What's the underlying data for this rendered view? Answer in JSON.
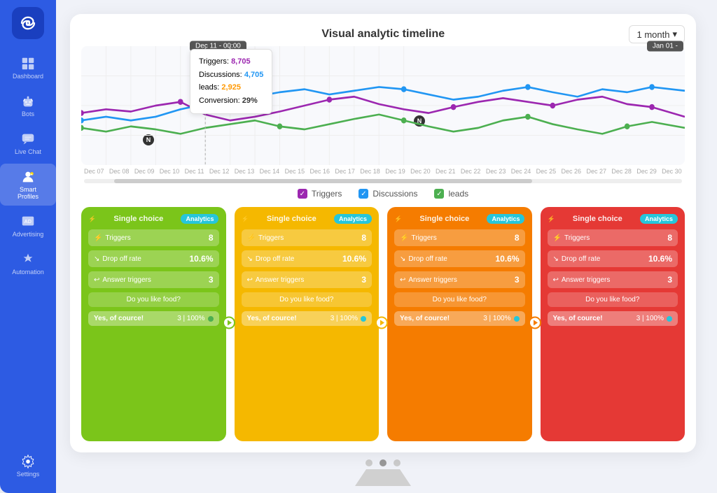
{
  "sidebar": {
    "logo_alt": "infinity-logo",
    "items": [
      {
        "id": "dashboard",
        "label": "Dashboard",
        "active": false
      },
      {
        "id": "bots",
        "label": "Bots",
        "active": false
      },
      {
        "id": "live-chat",
        "label": "Live Chat",
        "active": false
      },
      {
        "id": "smart-profiles",
        "label": "Smart Profiles",
        "active": true
      },
      {
        "id": "advertising",
        "label": "Advertising",
        "active": false
      },
      {
        "id": "automation",
        "label": "Automation",
        "active": false
      },
      {
        "id": "settings",
        "label": "Settings",
        "active": false
      }
    ]
  },
  "chart": {
    "title": "Visual analytic timeline",
    "time_filter": "1 month",
    "tooltip": {
      "date": "Dec 11 - 00:00",
      "date_right": "Jan 01 -",
      "triggers_label": "Triggers:",
      "triggers_value": "8,705",
      "discussions_label": "Discussions:",
      "discussions_value": "4,705",
      "leads_label": "leads:",
      "leads_value": "2,925",
      "conversion_label": "Conversion:",
      "conversion_value": "29%"
    },
    "x_labels": [
      "Dec 07",
      "Dec 08",
      "Dec 09",
      "Dec 10",
      "Dec 11",
      "Dec 12",
      "Dec 13",
      "Dec 14",
      "Dec 15",
      "Dec 16",
      "Dec 17",
      "Dec 18",
      "Dec 19",
      "Dec 20",
      "Dec 21",
      "Dec 22",
      "Dec 23",
      "Dec 24",
      "Dec 25",
      "Dec 26",
      "Dec 27",
      "Dec 28",
      "Dec 29",
      "Dec 30"
    ],
    "legend": [
      {
        "label": "Triggers",
        "color": "#9c27b0"
      },
      {
        "label": "Discussions",
        "color": "#2196f3"
      },
      {
        "label": "leads",
        "color": "#4caf50"
      }
    ]
  },
  "cards": [
    {
      "bg": "green",
      "type": "Single choice",
      "badge": "Analytics",
      "triggers_label": "Triggers",
      "triggers_value": "8",
      "drop_off_label": "Drop off rate",
      "drop_off_value": "10.6%",
      "answer_triggers_label": "Answer triggers",
      "answer_triggers_value": "3",
      "question": "Do you like food?",
      "answer_text": "Yes, of cource!",
      "answer_stats": "3 | 100%"
    },
    {
      "bg": "yellow",
      "type": "Single choice",
      "badge": "Analytics",
      "triggers_label": "Triggers",
      "triggers_value": "8",
      "drop_off_label": "Drop off rate",
      "drop_off_value": "10.6%",
      "answer_triggers_label": "Answer triggers",
      "answer_triggers_value": "3",
      "question": "Do you like food?",
      "answer_text": "Yes, of cource!",
      "answer_stats": "3 | 100%"
    },
    {
      "bg": "orange",
      "type": "Single choice",
      "badge": "Analytics",
      "triggers_label": "Triggers",
      "triggers_value": "8",
      "drop_off_label": "Drop off rate",
      "drop_off_value": "10.6%",
      "answer_triggers_label": "Answer triggers",
      "answer_triggers_value": "3",
      "question": "Do you like food?",
      "answer_text": "Yes, of cource!",
      "answer_stats": "3 | 100%"
    },
    {
      "bg": "red",
      "type": "Single choice",
      "badge": "Analytics",
      "triggers_label": "Triggers",
      "triggers_value": "8",
      "drop_off_label": "Drop off rate",
      "drop_off_value": "10.6%",
      "answer_triggers_label": "Answer triggers",
      "answer_triggers_value": "3",
      "question": "Do you like food?",
      "answer_text": "Yes, of cource!",
      "answer_stats": "3 | 100%"
    }
  ],
  "monitor_dots": [
    "dot1",
    "dot2",
    "dot3"
  ]
}
